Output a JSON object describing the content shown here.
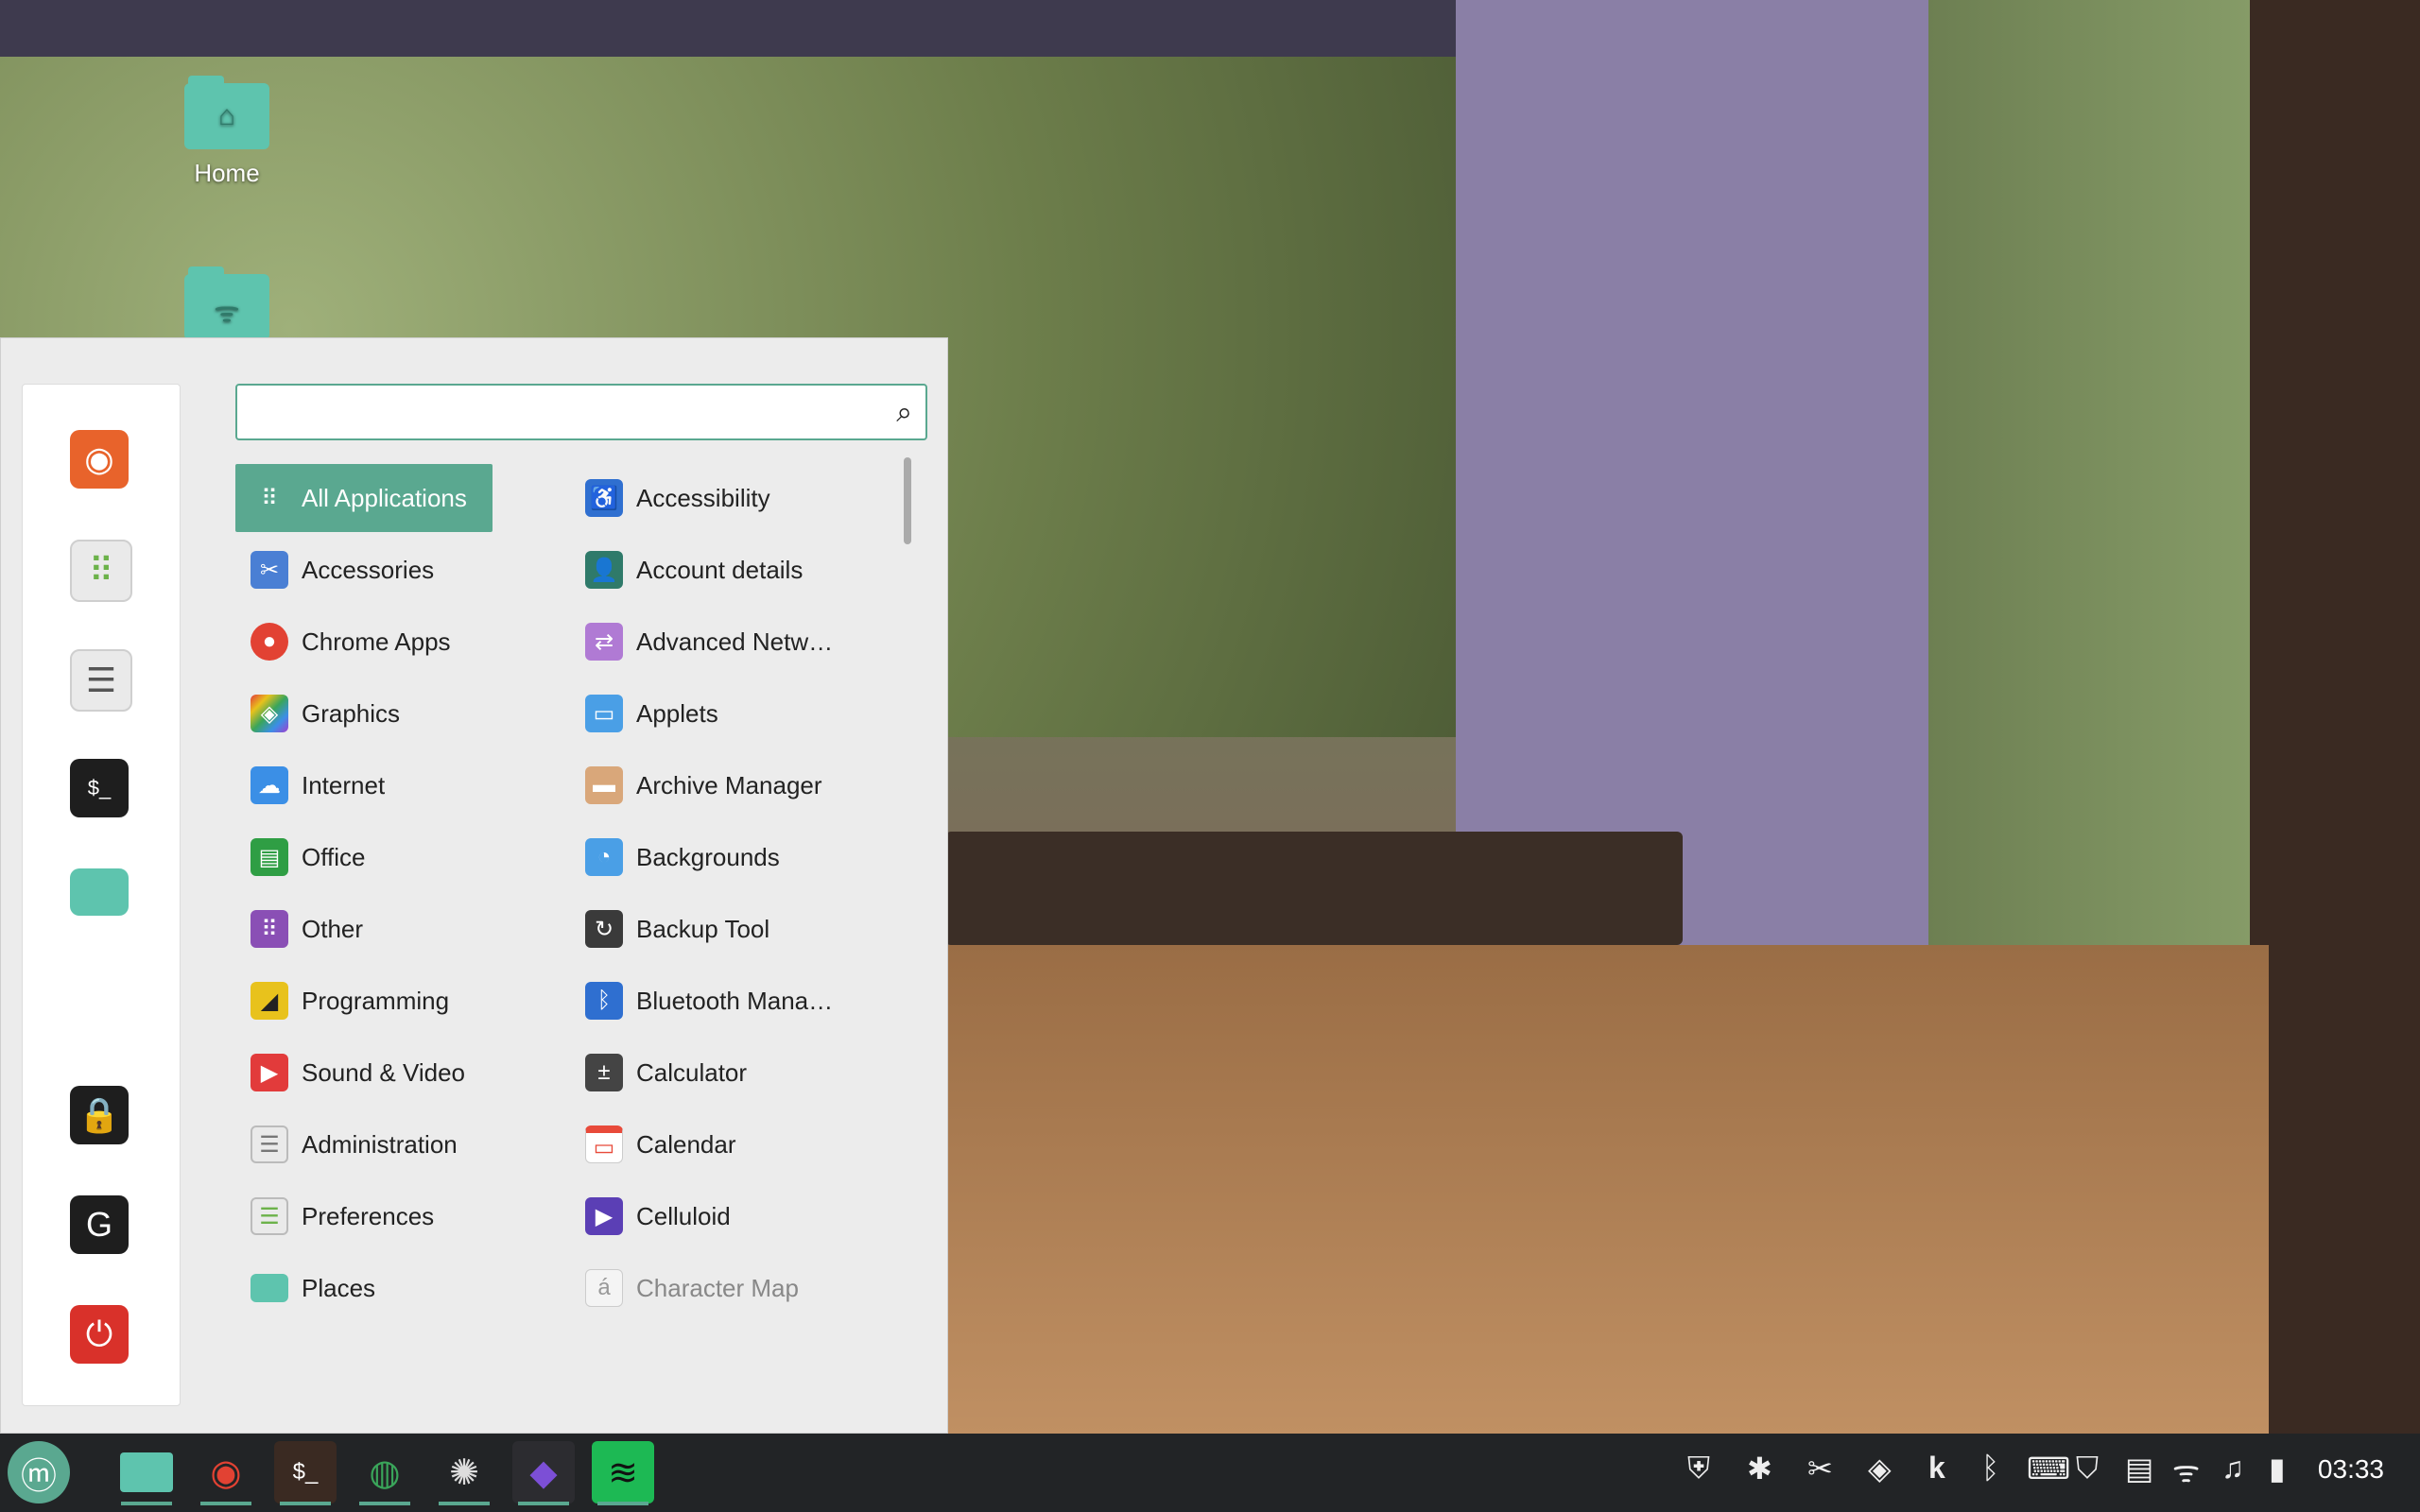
{
  "desktop": {
    "icons": [
      {
        "label": "Home",
        "glyph": "⌂",
        "icon": "home-folder-icon"
      },
      {
        "label": "",
        "glyph": "ᯤ",
        "icon": "network-folder-icon"
      }
    ]
  },
  "menu": {
    "search": {
      "value": "",
      "placeholder": ""
    },
    "favorites": [
      {
        "name": "firefox",
        "glyph": "◉",
        "color": "#e8632b"
      },
      {
        "name": "software-manager",
        "glyph": "⠿",
        "color": "#6cb24a"
      },
      {
        "name": "system-settings",
        "glyph": "☰",
        "color": "#cfcfcf"
      },
      {
        "name": "terminal",
        "glyph": "$_",
        "color": "#1e1e1e"
      },
      {
        "name": "files",
        "glyph": "",
        "color": "#5ec4ae"
      },
      {
        "name": "lock-screen",
        "glyph": "🔒",
        "color": "#1e1e1e"
      },
      {
        "name": "logout",
        "glyph": "G",
        "color": "#1e1e1e"
      },
      {
        "name": "shutdown",
        "glyph": "⏻",
        "color": "#d9312a"
      }
    ],
    "categories": [
      {
        "label": "All Applications",
        "glyph": "⠿",
        "color": "#5aa890"
      },
      {
        "label": "Accessories",
        "glyph": "✂",
        "color": "#4a7fd4"
      },
      {
        "label": "Chrome Apps",
        "glyph": "●",
        "color": "#e24233"
      },
      {
        "label": "Graphics",
        "glyph": "◈",
        "color": "#a13fcf"
      },
      {
        "label": "Internet",
        "glyph": "☁",
        "color": "#3b8fe6"
      },
      {
        "label": "Office",
        "glyph": "▤",
        "color": "#2f9e44"
      },
      {
        "label": "Other",
        "glyph": "⠿",
        "color": "#8a4fb5"
      },
      {
        "label": "Programming",
        "glyph": "◢",
        "color": "#e8c21c"
      },
      {
        "label": "Sound & Video",
        "glyph": "▶",
        "color": "#e23b3b"
      },
      {
        "label": "Administration",
        "glyph": "☰",
        "color": "#9a9a9a"
      },
      {
        "label": "Preferences",
        "glyph": "☰",
        "color": "#6cb24a"
      },
      {
        "label": "Places",
        "glyph": "",
        "color": "#5ec4ae"
      }
    ],
    "apps": [
      {
        "label": "Accessibility",
        "glyph": "♿",
        "color": "#2f6fd0"
      },
      {
        "label": "Account details",
        "glyph": "👤",
        "color": "#2f7a6a"
      },
      {
        "label": "Advanced Netw…",
        "glyph": "⇄",
        "color": "#b07ad4"
      },
      {
        "label": "Applets",
        "glyph": "▭",
        "color": "#4a9fe6"
      },
      {
        "label": "Archive Manager",
        "glyph": "▬",
        "color": "#d9a77a"
      },
      {
        "label": "Backgrounds",
        "glyph": "◔",
        "color": "#4a9fe6"
      },
      {
        "label": "Backup Tool",
        "glyph": "↻",
        "color": "#3a3a3a"
      },
      {
        "label": "Bluetooth Mana…",
        "glyph": "ᛒ",
        "color": "#2f6fd0"
      },
      {
        "label": "Calculator",
        "glyph": "±",
        "color": "#444444"
      },
      {
        "label": "Calendar",
        "glyph": "▭",
        "color": "#e84a3a"
      },
      {
        "label": "Celluloid",
        "glyph": "▶",
        "color": "#5b3fb5"
      },
      {
        "label": "Character Map",
        "glyph": "á",
        "color": "#e0e0e0"
      }
    ]
  },
  "taskbar": {
    "items": [
      {
        "name": "menu-button",
        "glyph": "ⓜ",
        "color": "#5aa890"
      },
      {
        "name": "files",
        "glyph": "",
        "color": "#5ec4ae"
      },
      {
        "name": "chrome",
        "glyph": "◉",
        "color": "#e24233"
      },
      {
        "name": "terminal",
        "glyph": "$_",
        "color": "#3a2a22"
      },
      {
        "name": "web-browser",
        "glyph": "◍",
        "color": "#3aa55a"
      },
      {
        "name": "chatgpt",
        "glyph": "✺",
        "color": "#2a2a2a"
      },
      {
        "name": "obsidian",
        "glyph": "◆",
        "color": "#7c4fd6"
      },
      {
        "name": "spotify",
        "glyph": "≋",
        "color": "#1db954"
      }
    ],
    "tray": [
      "⛨",
      "✱",
      "✂",
      "◈",
      "k",
      "ᛒ",
      "⌨",
      "⛉",
      "▤",
      "ᯤ",
      "♫",
      "▮"
    ],
    "clock": "03:33"
  }
}
